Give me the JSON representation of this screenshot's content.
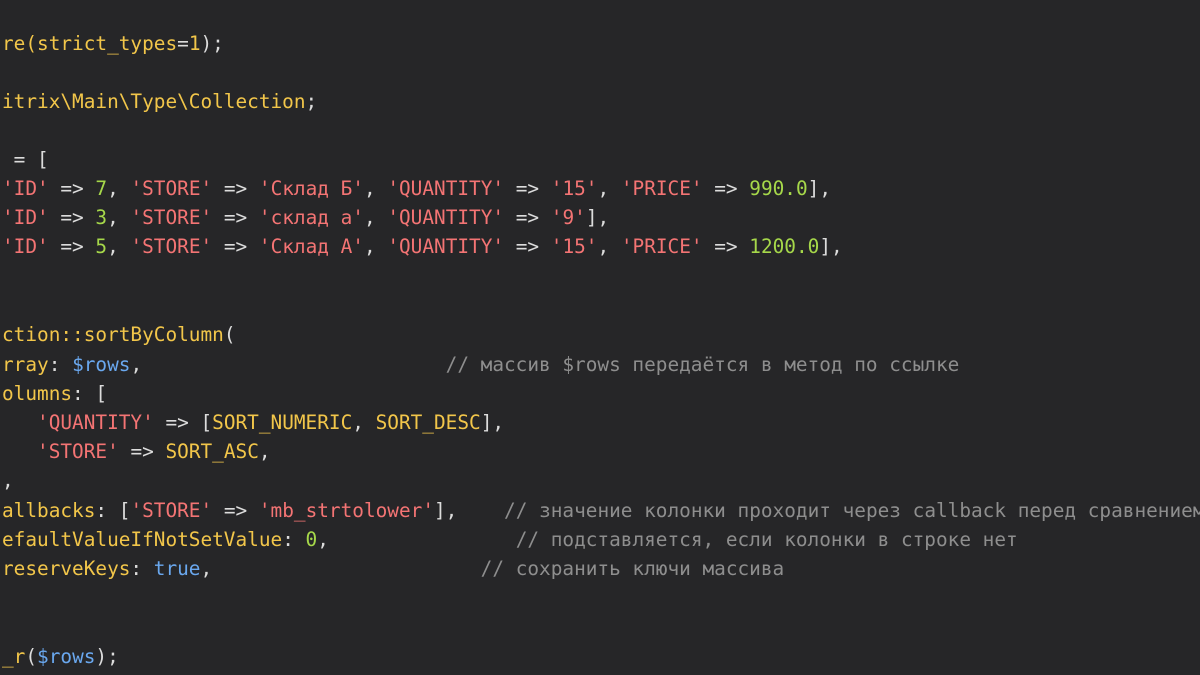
{
  "editor": {
    "background": "#262628",
    "colors": {
      "default": "#dcdcdc",
      "function": "#f2c64a",
      "string": "#f47474",
      "number": "#a6d84a",
      "variable": "#6aa8ef",
      "comment": "#8e8e8e"
    },
    "lines": [
      {
        "tokens": [
          {
            "t": "re(",
            "k": "func"
          },
          {
            "t": "strict_types",
            "k": "func"
          },
          {
            "t": "=",
            "k": "op"
          },
          {
            "t": "1",
            "k": "func"
          },
          {
            "t": ");",
            "k": "op"
          }
        ]
      },
      {
        "tokens": [
          {
            "t": "itrix\\Main\\Type\\Collection",
            "k": "func"
          },
          {
            "t": ";",
            "k": "op"
          }
        ]
      },
      {
        "tokens": [
          {
            "t": " = [",
            "k": "op"
          }
        ]
      },
      {
        "tokens": [
          {
            "t": "'ID'",
            "k": "string"
          },
          {
            "t": " => ",
            "k": "op"
          },
          {
            "t": "7",
            "k": "number"
          },
          {
            "t": ", ",
            "k": "op"
          },
          {
            "t": "'STORE'",
            "k": "string"
          },
          {
            "t": " => ",
            "k": "op"
          },
          {
            "t": "'Склад Б'",
            "k": "string"
          },
          {
            "t": ", ",
            "k": "op"
          },
          {
            "t": "'QUANTITY'",
            "k": "string"
          },
          {
            "t": " => ",
            "k": "op"
          },
          {
            "t": "'15'",
            "k": "string"
          },
          {
            "t": ", ",
            "k": "op"
          },
          {
            "t": "'PRICE'",
            "k": "string"
          },
          {
            "t": " => ",
            "k": "op"
          },
          {
            "t": "990.0",
            "k": "number"
          },
          {
            "t": "],",
            "k": "op"
          }
        ]
      },
      {
        "tokens": [
          {
            "t": "'ID'",
            "k": "string"
          },
          {
            "t": " => ",
            "k": "op"
          },
          {
            "t": "3",
            "k": "number"
          },
          {
            "t": ", ",
            "k": "op"
          },
          {
            "t": "'STORE'",
            "k": "string"
          },
          {
            "t": " => ",
            "k": "op"
          },
          {
            "t": "'склад а'",
            "k": "string"
          },
          {
            "t": ", ",
            "k": "op"
          },
          {
            "t": "'QUANTITY'",
            "k": "string"
          },
          {
            "t": " => ",
            "k": "op"
          },
          {
            "t": "'9'",
            "k": "string"
          },
          {
            "t": "],",
            "k": "op"
          }
        ]
      },
      {
        "tokens": [
          {
            "t": "'ID'",
            "k": "string"
          },
          {
            "t": " => ",
            "k": "op"
          },
          {
            "t": "5",
            "k": "number"
          },
          {
            "t": ", ",
            "k": "op"
          },
          {
            "t": "'STORE'",
            "k": "string"
          },
          {
            "t": " => ",
            "k": "op"
          },
          {
            "t": "'Склад А'",
            "k": "string"
          },
          {
            "t": ", ",
            "k": "op"
          },
          {
            "t": "'QUANTITY'",
            "k": "string"
          },
          {
            "t": " => ",
            "k": "op"
          },
          {
            "t": "'15'",
            "k": "string"
          },
          {
            "t": ", ",
            "k": "op"
          },
          {
            "t": "'PRICE'",
            "k": "string"
          },
          {
            "t": " => ",
            "k": "op"
          },
          {
            "t": "1200.0",
            "k": "number"
          },
          {
            "t": "],",
            "k": "op"
          }
        ]
      },
      {
        "tokens": [
          {
            "t": "ction::sortByColumn",
            "k": "func"
          },
          {
            "t": "(",
            "k": "op"
          }
        ]
      },
      {
        "tokens": [
          {
            "t": "rray",
            "k": "param"
          },
          {
            "t": ": ",
            "k": "op"
          },
          {
            "t": "$rows",
            "k": "var"
          },
          {
            "t": ",                          ",
            "k": "op"
          },
          {
            "t": "// массив $rows передаётся в метод по ссылке",
            "k": "comment"
          }
        ]
      },
      {
        "tokens": [
          {
            "t": "olumns",
            "k": "param"
          },
          {
            "t": ": [",
            "k": "op"
          }
        ]
      },
      {
        "tokens": [
          {
            "t": "   ",
            "k": "op"
          },
          {
            "t": "'QUANTITY'",
            "k": "string"
          },
          {
            "t": " => [",
            "k": "op"
          },
          {
            "t": "SORT_NUMERIC",
            "k": "const"
          },
          {
            "t": ", ",
            "k": "op"
          },
          {
            "t": "SORT_DESC",
            "k": "const"
          },
          {
            "t": "],",
            "k": "op"
          }
        ]
      },
      {
        "tokens": [
          {
            "t": "   ",
            "k": "op"
          },
          {
            "t": "'STORE'",
            "k": "string"
          },
          {
            "t": " => ",
            "k": "op"
          },
          {
            "t": "SORT_ASC",
            "k": "const"
          },
          {
            "t": ",",
            "k": "op"
          }
        ]
      },
      {
        "tokens": [
          {
            "t": ",",
            "k": "op"
          }
        ]
      },
      {
        "tokens": [
          {
            "t": "allbacks",
            "k": "param"
          },
          {
            "t": ": [",
            "k": "op"
          },
          {
            "t": "'STORE'",
            "k": "string"
          },
          {
            "t": " => ",
            "k": "op"
          },
          {
            "t": "'mb_strtolower'",
            "k": "string"
          },
          {
            "t": "],    ",
            "k": "op"
          },
          {
            "t": "// значение колонки проходит через callback перед сравнением",
            "k": "comment"
          }
        ]
      },
      {
        "tokens": [
          {
            "t": "efaultValueIfNotSetValue",
            "k": "param"
          },
          {
            "t": ": ",
            "k": "op"
          },
          {
            "t": "0",
            "k": "number"
          },
          {
            "t": ",                ",
            "k": "op"
          },
          {
            "t": "// подставляется, если колонки в строке нет",
            "k": "comment"
          }
        ]
      },
      {
        "tokens": [
          {
            "t": "reserveKeys",
            "k": "param"
          },
          {
            "t": ": ",
            "k": "op"
          },
          {
            "t": "true",
            "k": "bool"
          },
          {
            "t": ",                       ",
            "k": "op"
          },
          {
            "t": "// сохранить ключи массива",
            "k": "comment"
          }
        ]
      },
      {
        "tokens": [
          {
            "t": "_r",
            "k": "func"
          },
          {
            "t": "(",
            "k": "op"
          },
          {
            "t": "$rows",
            "k": "var"
          },
          {
            "t": ");",
            "k": "op"
          }
        ]
      }
    ]
  }
}
